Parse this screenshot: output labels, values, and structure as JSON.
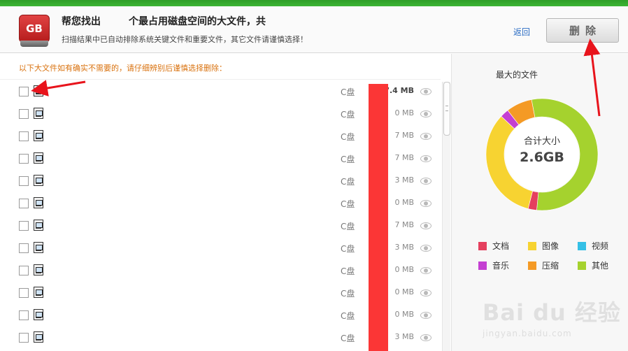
{
  "header": {
    "headline_prefix": "帮您找出",
    "headline_suffix": "个最占用磁盘空间的大文件，共",
    "subline": "扫描结果中已自动排除系统关键文件和重要文件，其它文件请谨慎选择！",
    "icon_text": "GB",
    "back_label": "返回",
    "delete_label": "删除"
  },
  "list": {
    "hint": "以下大文件如有确实不需要的，请仔细辨别后谨慎选择删除：",
    "rows": [
      {
        "drive": "C盘",
        "size": "7.4 MB"
      },
      {
        "drive": "C盘",
        "size": "0 MB"
      },
      {
        "drive": "C盘",
        "size": "7 MB"
      },
      {
        "drive": "C盘",
        "size": "7 MB"
      },
      {
        "drive": "C盘",
        "size": "3 MB"
      },
      {
        "drive": "C盘",
        "size": "0 MB"
      },
      {
        "drive": "C盘",
        "size": "7 MB"
      },
      {
        "drive": "C盘",
        "size": "3 MB"
      },
      {
        "drive": "C盘",
        "size": "0 MB"
      },
      {
        "drive": "C盘",
        "size": "0 MB"
      },
      {
        "drive": "C盘",
        "size": "0 MB"
      },
      {
        "drive": "C盘",
        "size": "3 MB"
      }
    ]
  },
  "side": {
    "title": "最大的文件",
    "total_label": "合计大小",
    "total_value": "2.6GB",
    "segments": [
      {
        "name": "其他",
        "fraction": 0.545,
        "color": "#a5d22e"
      },
      {
        "name": "文档",
        "fraction": 0.025,
        "color": "#e5405e"
      },
      {
        "name": "图像",
        "fraction": 0.33,
        "color": "#f7d331"
      },
      {
        "name": "音乐",
        "fraction": 0.025,
        "color": "#c43fd2"
      },
      {
        "name": "压缩",
        "fraction": 0.075,
        "color": "#f49a25"
      }
    ],
    "legend": [
      {
        "name": "文档",
        "color": "#e5405e"
      },
      {
        "name": "图像",
        "color": "#f7d331"
      },
      {
        "name": "视频",
        "color": "#35c0e6"
      },
      {
        "name": "音乐",
        "color": "#c43fd2"
      },
      {
        "name": "压缩",
        "color": "#f49a25"
      },
      {
        "name": "其他",
        "color": "#a5d22e"
      }
    ]
  },
  "watermark": {
    "brand": "Bai du 经验",
    "url": "jingyan.baidu.com"
  }
}
